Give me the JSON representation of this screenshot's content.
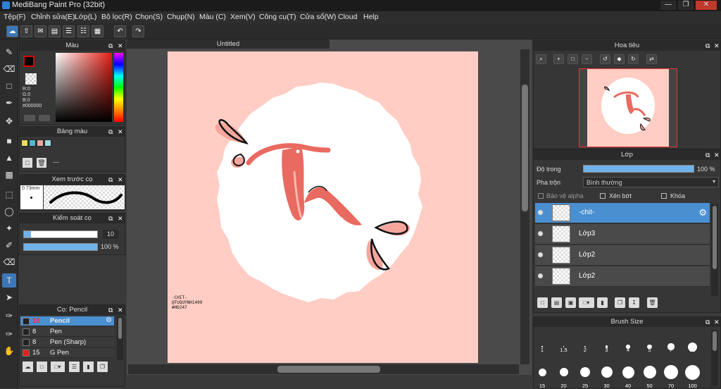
{
  "window": {
    "title": "MediBang Paint Pro (32bit)"
  },
  "menu": [
    "Tệp(F)",
    "Chỉnh sửa(E)",
    "Lớp(L)",
    "Bộ lọc(R)",
    "Chọn(S)",
    "Chụp(N)",
    "Màu (C)",
    "Xem(V)",
    "Công cụ(T)",
    "Cửa sổ(W)",
    "Cloud",
    "Help"
  ],
  "color_panel": {
    "title": "Màu",
    "r": "R:0",
    "g": "G:0",
    "b": "B:0",
    "hex": "#000000",
    "primary": "#000000",
    "secondary": "#ffffff"
  },
  "palette_panel": {
    "title": "Bảng màu",
    "swatches": [
      "#e8e05a",
      "#4fb8c9",
      "#e7a9a0",
      "#9fdadc"
    ],
    "placeholder": "---"
  },
  "preview_panel": {
    "title": "Xem trước cọ",
    "size": "0.73mm"
  },
  "control_panel": {
    "title": "Kiểm soát cọ",
    "size_value": "10",
    "opacity_value": "100 %",
    "size_fraction": 0.1,
    "opacity_fraction": 1.0
  },
  "brush_panel": {
    "title": "Cọ: Pencil",
    "items": [
      {
        "size": "10",
        "name": "Pencil",
        "color": "#222222",
        "selected": true
      },
      {
        "size": "8",
        "name": "Pen",
        "color": "#222222",
        "selected": false
      },
      {
        "size": "8",
        "name": "Pen (Sharp)",
        "color": "#222222",
        "selected": false
      },
      {
        "size": "15",
        "name": "G Pen",
        "color": "#e02020",
        "selected": false
      }
    ]
  },
  "document": {
    "tab_title": "Untitled",
    "signature_lines": [
      "-CHIT-",
      "@TUQUYNH1409",
      "#HD247"
    ]
  },
  "navigator": {
    "title": "Hoa tiêu"
  },
  "layers": {
    "title": "Lớp",
    "opacity_label": "Độ trong",
    "opacity_value": "100 %",
    "opacity_fraction": 1.0,
    "blend_label": "Pha trộn",
    "blend_value": "Bình thường",
    "protect_alpha": "Bảo vệ alpha",
    "clipping": "Xén bớt",
    "lock": "Khóa",
    "items": [
      {
        "name": "-chit-",
        "selected": true
      },
      {
        "name": "Lớp3",
        "selected": false
      },
      {
        "name": "Lớp2",
        "selected": false
      },
      {
        "name": "Lớp2",
        "selected": false
      }
    ]
  },
  "brush_size": {
    "title": "Brush Size",
    "labels": [
      "1",
      "1.5",
      "2",
      "3",
      "4",
      "5",
      "7",
      "10"
    ],
    "second_labels": [
      "15",
      "20",
      "25",
      "30",
      "40",
      "50",
      "70",
      "100"
    ]
  },
  "colors": {
    "accent": "#4a8fd0",
    "canvas": "#ffcdc4",
    "ink": "#e96a60"
  }
}
